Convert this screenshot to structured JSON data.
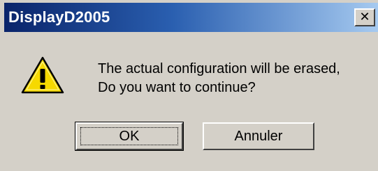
{
  "window": {
    "title": "DisplayD2005",
    "close_glyph": "✕"
  },
  "message": {
    "icon": "warning-icon",
    "line1": "The actual configuration will be erased,",
    "line2": "Do you want to continue?"
  },
  "buttons": {
    "ok_label": "OK",
    "cancel_label": "Annuler"
  },
  "colors": {
    "titlebar_start": "#0a246a",
    "titlebar_end": "#a6caf0",
    "dialog_face": "#d4d0c8",
    "warning_yellow": "#f6d900"
  }
}
